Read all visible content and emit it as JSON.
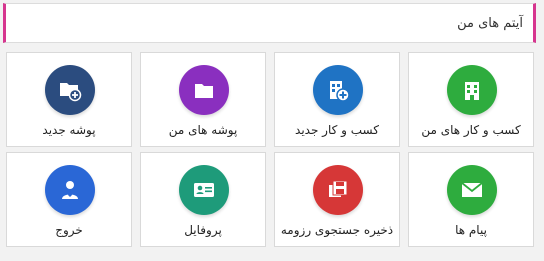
{
  "header": {
    "title": "آیتم های من"
  },
  "tiles": [
    {
      "label": "کسب و کار های من",
      "color": "#2eac3e",
      "icon": "building-icon"
    },
    {
      "label": "کسب و کار جدید",
      "color": "#1f73c4",
      "icon": "add-building-icon"
    },
    {
      "label": "پوشه های من",
      "color": "#8a2fbf",
      "icon": "folder-icon"
    },
    {
      "label": "پوشه جدید",
      "color": "#2b4c7f",
      "icon": "add-folder-icon"
    },
    {
      "label": "پیام ها",
      "color": "#2eac3e",
      "icon": "envelope-icon"
    },
    {
      "label": "ذخیره جستجوی رزومه",
      "color": "#d63737",
      "icon": "save-search-icon"
    },
    {
      "label": "پروفایل",
      "color": "#1e9b7a",
      "icon": "id-card-icon"
    },
    {
      "label": "خروج",
      "color": "#2a67d6",
      "icon": "user-logout-icon"
    }
  ]
}
